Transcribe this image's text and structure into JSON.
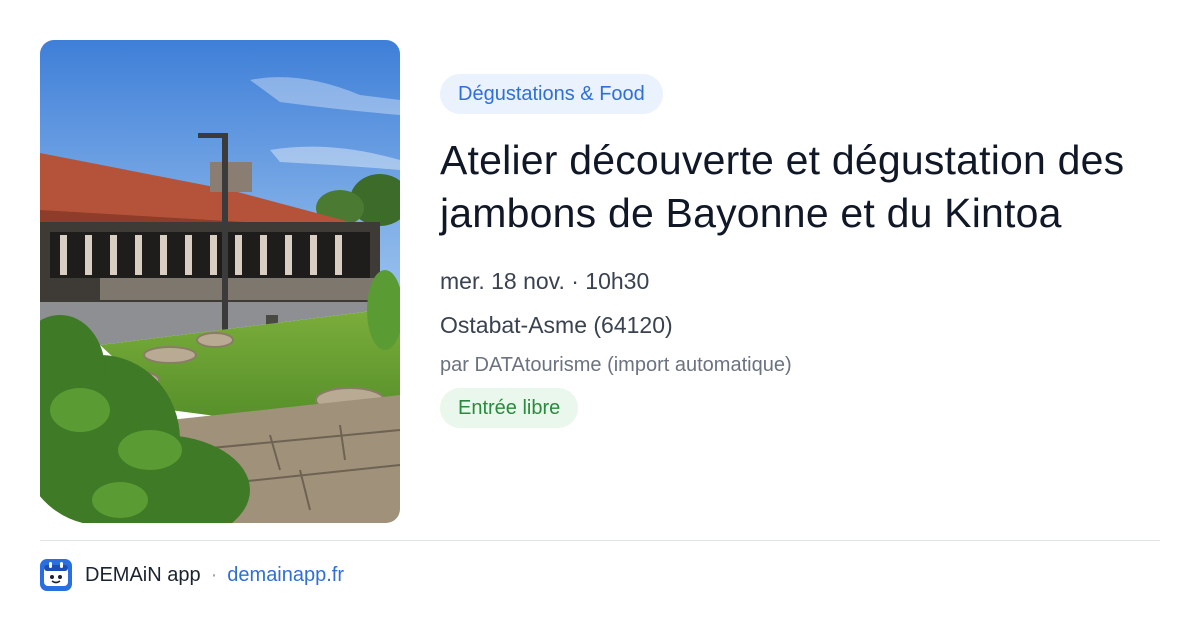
{
  "event": {
    "category": "Dégustations & Food",
    "title": "Atelier découverte et dégustation des jambons de Bayonne et du Kintoa",
    "date_time": "mer. 18 nov. · 10h30",
    "location": "Ostabat-Asme (64120)",
    "source": "par DATAtourisme (import automatique)",
    "price": "Entrée libre"
  },
  "footer": {
    "app_name": "DEMAiN app",
    "separator": "·",
    "url": "demainapp.fr"
  },
  "colors": {
    "category_text": "#2f6fd6",
    "category_bg": "#eaf2fd",
    "price_text": "#2b8a3e",
    "price_bg": "#e9f7ec",
    "logo_bg": "#2a6fe0"
  },
  "icons": {
    "app_logo": "demain-app-logo-icon"
  }
}
